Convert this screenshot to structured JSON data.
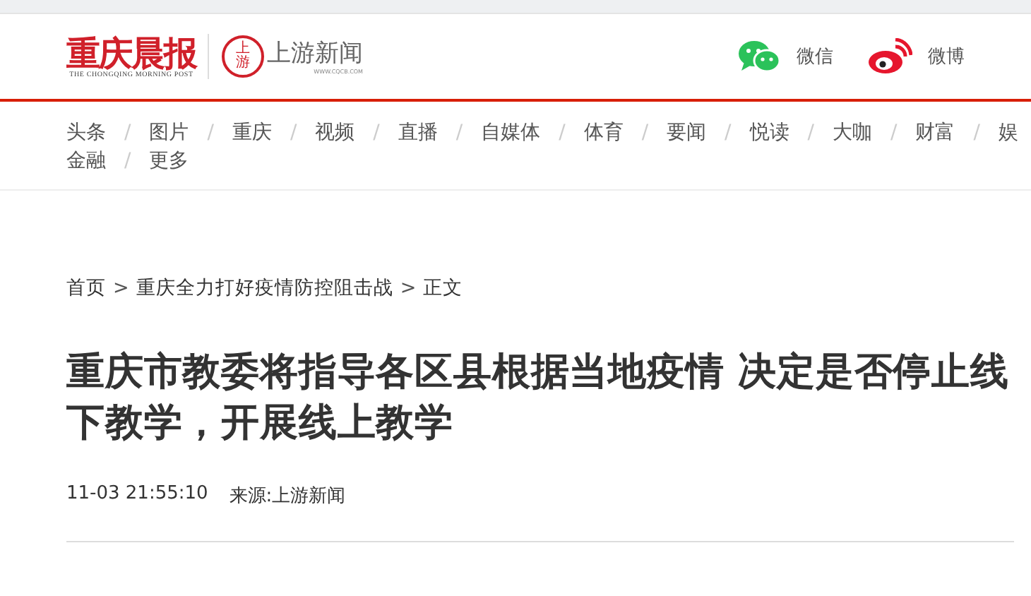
{
  "header": {
    "logo": {
      "name": "重庆晨报",
      "subtitle": "THE CHONGQING MORNING POST"
    },
    "partner": {
      "badge": "上游",
      "name": "上游新闻",
      "url": "WWW.CQCB.COM"
    },
    "social": [
      {
        "kind": "wechat",
        "label": "微信"
      },
      {
        "kind": "weibo",
        "label": "微博"
      }
    ]
  },
  "nav": {
    "separator": "/",
    "rows": [
      [
        "头条",
        "图片",
        "重庆",
        "视频",
        "直播",
        "自媒体",
        "体育",
        "要闻",
        "悦读",
        "大咖",
        "财富",
        "娱"
      ],
      [
        "金融",
        "更多"
      ]
    ]
  },
  "breadcrumb": {
    "separator": ">",
    "items": [
      "首页",
      "重庆全力打好疫情防控阻击战",
      "正文"
    ]
  },
  "article": {
    "title": "重庆市教委将指导各区县根据当地疫情 决定是否停止线下教学，开展线上教学",
    "time": "11-03 21:55:10",
    "source": "来源:上游新闻"
  }
}
